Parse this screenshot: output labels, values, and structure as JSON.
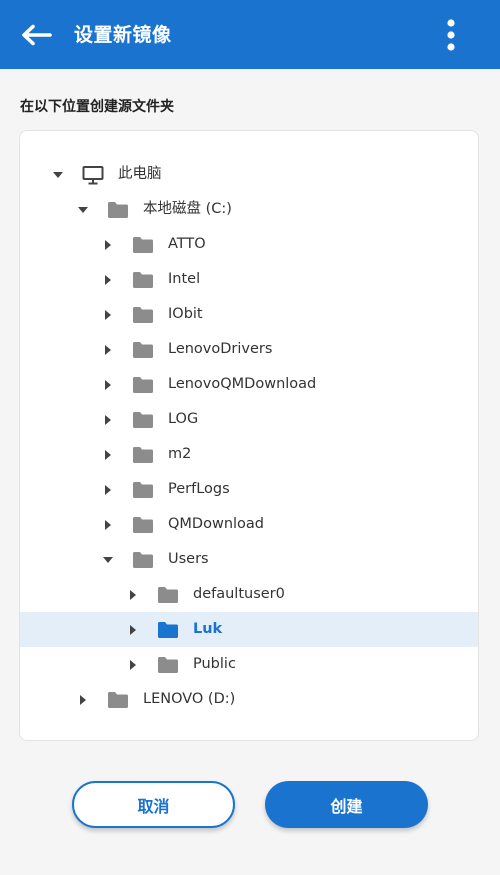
{
  "header": {
    "title": "设置新镜像",
    "back_icon": "arrow-left-icon",
    "more_icon": "more-vert-icon"
  },
  "section_label": "在以下位置创建源文件夹",
  "tree": [
    {
      "label": "此电脑",
      "icon": "computer-icon",
      "state": "expanded",
      "level": 0
    },
    {
      "label": "本地磁盘 (C:)",
      "icon": "folder-icon",
      "state": "expanded",
      "level": 1
    },
    {
      "label": "ATTO",
      "icon": "folder-icon",
      "state": "collapsed",
      "level": 2
    },
    {
      "label": "Intel",
      "icon": "folder-icon",
      "state": "collapsed",
      "level": 2
    },
    {
      "label": "IObit",
      "icon": "folder-icon",
      "state": "collapsed",
      "level": 2
    },
    {
      "label": "LenovoDrivers",
      "icon": "folder-icon",
      "state": "collapsed",
      "level": 2
    },
    {
      "label": "LenovoQMDownload",
      "icon": "folder-icon",
      "state": "collapsed",
      "level": 2
    },
    {
      "label": "LOG",
      "icon": "folder-icon",
      "state": "collapsed",
      "level": 2
    },
    {
      "label": "m2",
      "icon": "folder-icon",
      "state": "collapsed",
      "level": 2
    },
    {
      "label": "PerfLogs",
      "icon": "folder-icon",
      "state": "collapsed",
      "level": 2
    },
    {
      "label": "QMDownload",
      "icon": "folder-icon",
      "state": "collapsed",
      "level": 2
    },
    {
      "label": "Users",
      "icon": "folder-icon",
      "state": "expanded",
      "level": 2
    },
    {
      "label": "defaultuser0",
      "icon": "folder-icon",
      "state": "collapsed",
      "level": 3
    },
    {
      "label": "Luk",
      "icon": "folder-icon",
      "state": "collapsed",
      "level": 3,
      "selected": true
    },
    {
      "label": "Public",
      "icon": "folder-icon",
      "state": "collapsed",
      "level": 3
    },
    {
      "label": "LENOVO (D:)",
      "icon": "folder-icon",
      "state": "collapsed",
      "level": 1
    }
  ],
  "buttons": {
    "cancel": "取消",
    "create": "创建"
  },
  "colors": {
    "accent": "#1a73cf",
    "selected_row": "#e3eef9",
    "folder": "#8c8c8c"
  }
}
